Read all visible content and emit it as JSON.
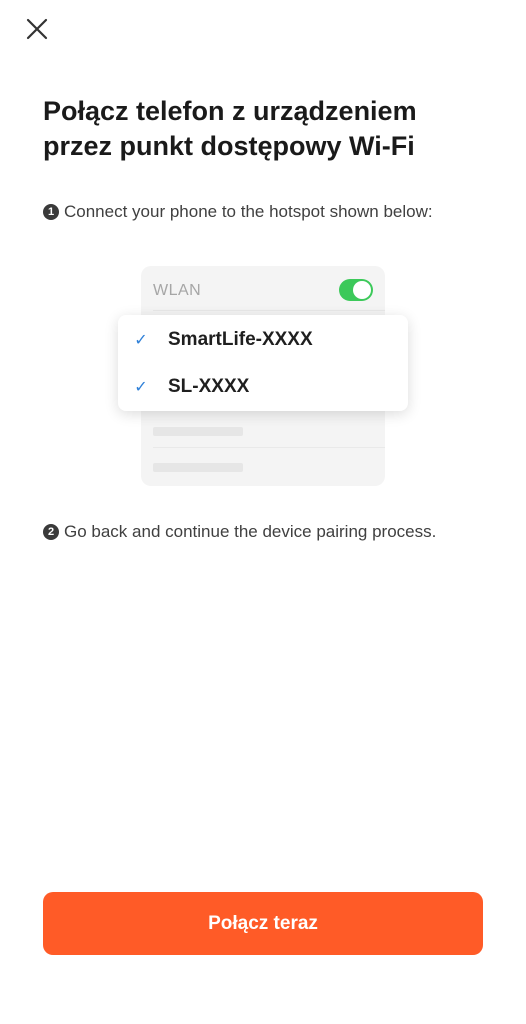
{
  "header": {
    "close_icon": "close-icon"
  },
  "title": "Połącz telefon z urządzeniem przez punkt dostępowy Wi-Fi",
  "steps": [
    {
      "number": "1",
      "text": "Connect your phone to the hotspot shown below:"
    },
    {
      "number": "2",
      "text": "Go back and continue the device pairing process."
    }
  ],
  "illustration": {
    "wlan_label": "WLAN",
    "toggle_on": true,
    "toggle_color": "#3cc95a",
    "networks": [
      {
        "ssid": "SmartLife-XXXX",
        "checked": true
      },
      {
        "ssid": "SL-XXXX",
        "checked": true
      }
    ],
    "check_icon": "check-icon",
    "check_color": "#2f80d8"
  },
  "connect_button": {
    "label": "Połącz teraz",
    "color": "#ff5b27"
  }
}
